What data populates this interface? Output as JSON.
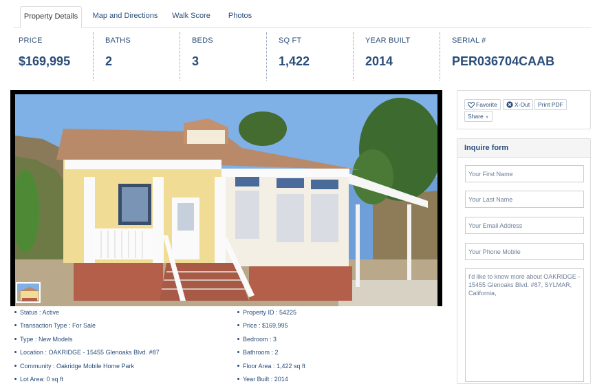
{
  "tabs": [
    {
      "label": "Property Details",
      "active": true
    },
    {
      "label": "Map and Directions",
      "active": false
    },
    {
      "label": "Walk Score",
      "active": false
    },
    {
      "label": "Photos",
      "active": false
    }
  ],
  "stats": [
    {
      "label": "PRICE",
      "value": "$169,995"
    },
    {
      "label": "BATHS",
      "value": "2"
    },
    {
      "label": "BEDS",
      "value": "3"
    },
    {
      "label": "SQ FT",
      "value": "1,422"
    },
    {
      "label": "YEAR BUILT",
      "value": "2014"
    },
    {
      "label": "SERIAL #",
      "value": "PER036704CAAB"
    }
  ],
  "details_left": [
    "Status : Active",
    "Transaction Type : For Sale",
    "Type : New Models",
    "Location : OAKRIDGE - 15455 Glenoaks Blvd. #87",
    "Community : Oakridge Mobile Home Park",
    "Lot Area: 0 sq ft"
  ],
  "details_right": [
    "Property ID : 54225",
    "Price : $169,995",
    "Bedroom : 3",
    "Bathroom : 2",
    "Floor Area : 1,422 sq ft",
    "Year Built : 2014"
  ],
  "actions": {
    "favorite": "Favorite",
    "xout": "X-Out",
    "print": "Print PDF",
    "share": "Share"
  },
  "inquire": {
    "title": "Inquire form",
    "first_name_placeholder": "Your First Name",
    "last_name_placeholder": "Your Last Name",
    "email_placeholder": "Your Email Address",
    "phone_placeholder": "Your Phone Mobile",
    "message": "I'd like to know more about OAKRIDGE - 15455 Glenoaks Blvd. #87, SYLMAR, California,"
  },
  "colors": {
    "accent": "#2a4d7a",
    "border": "#dddddd"
  },
  "icons": {
    "favorite": "heart-icon",
    "xout": "x-circle-icon",
    "share": "chevron-down-icon"
  }
}
